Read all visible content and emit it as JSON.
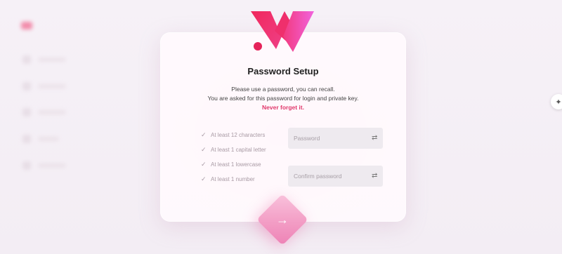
{
  "setup": {
    "title": "Password Setup",
    "line1": "Please use a password, you can recall.",
    "line2": "You are asked for this password for login and private key.",
    "warning": "Never forget it."
  },
  "requirements": [
    {
      "label": "At least 12 characters",
      "icon": "check-icon"
    },
    {
      "label": "At least 1 capital letter",
      "icon": "check-icon"
    },
    {
      "label": "At least 1 lowercase",
      "icon": "check-icon"
    },
    {
      "label": "At least 1 number",
      "icon": "check-icon"
    }
  ],
  "fields": {
    "password": {
      "placeholder": "Password",
      "value": "",
      "icon": "visibility-toggle-icon"
    },
    "confirm": {
      "placeholder": "Confirm password",
      "value": "",
      "icon": "visibility-toggle-icon"
    }
  },
  "next_button": {
    "icon": "arrow-right-icon",
    "glyph": "→"
  },
  "side_button": {
    "icon": "sparkle-icon",
    "glyph": "✦"
  },
  "colors": {
    "accent": "#e0386b",
    "brand_gradient_start": "#f02a5e",
    "brand_gradient_end": "#f05bd8",
    "background": "#f4eff5"
  }
}
